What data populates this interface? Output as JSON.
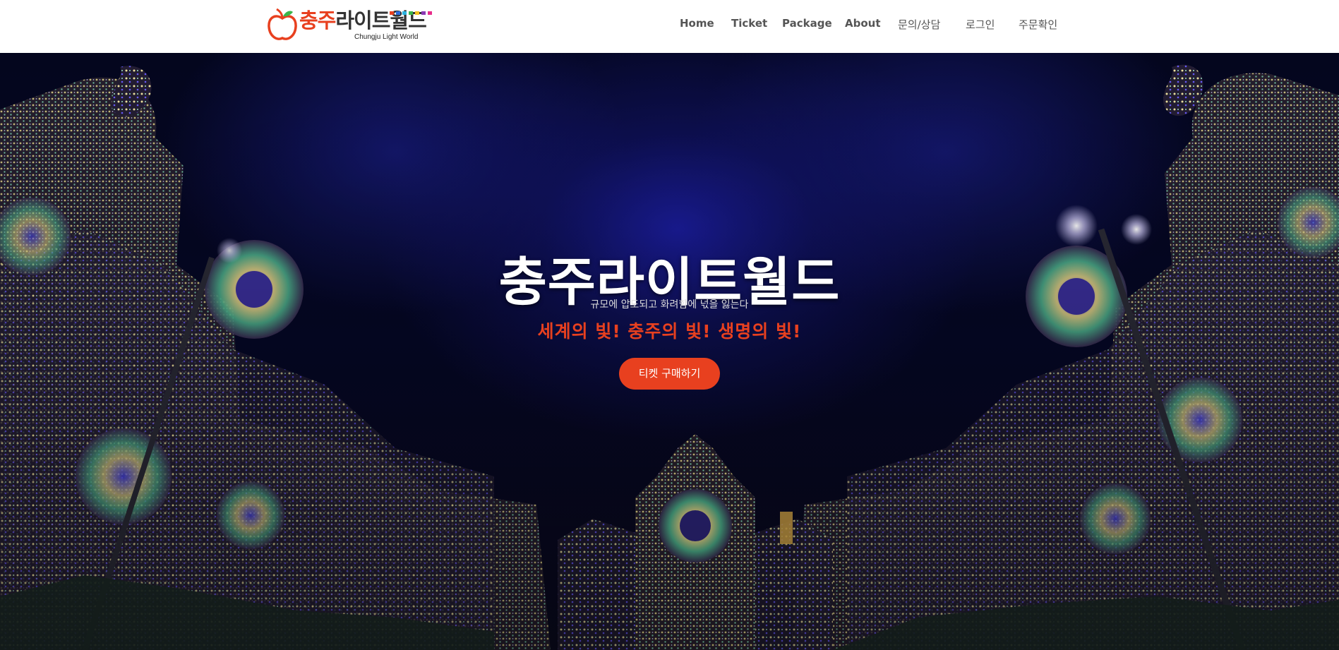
{
  "brand": {
    "name_part1": "충주",
    "name_part2": "라이트월드",
    "sub": "Chungju Light World",
    "accent": "#e8401f",
    "dots": [
      "#e8401f",
      "#2b6de0",
      "#2bb3e0",
      "#3ab54a",
      "#f2c01f",
      "#8a3ab5",
      "#e82c8a"
    ]
  },
  "nav": {
    "items": [
      "Home",
      "Ticket",
      "Package",
      "About",
      "문의/상담",
      "로그인",
      "주문확인"
    ]
  },
  "hero": {
    "title": "충주라이트월드",
    "subtitle": "규모에 압도되고 화려함에 넋을 잃는다",
    "slogan": "세계의 빛! 충주의 빛! 생명의 빛!",
    "cta": "티켓 구매하기"
  }
}
